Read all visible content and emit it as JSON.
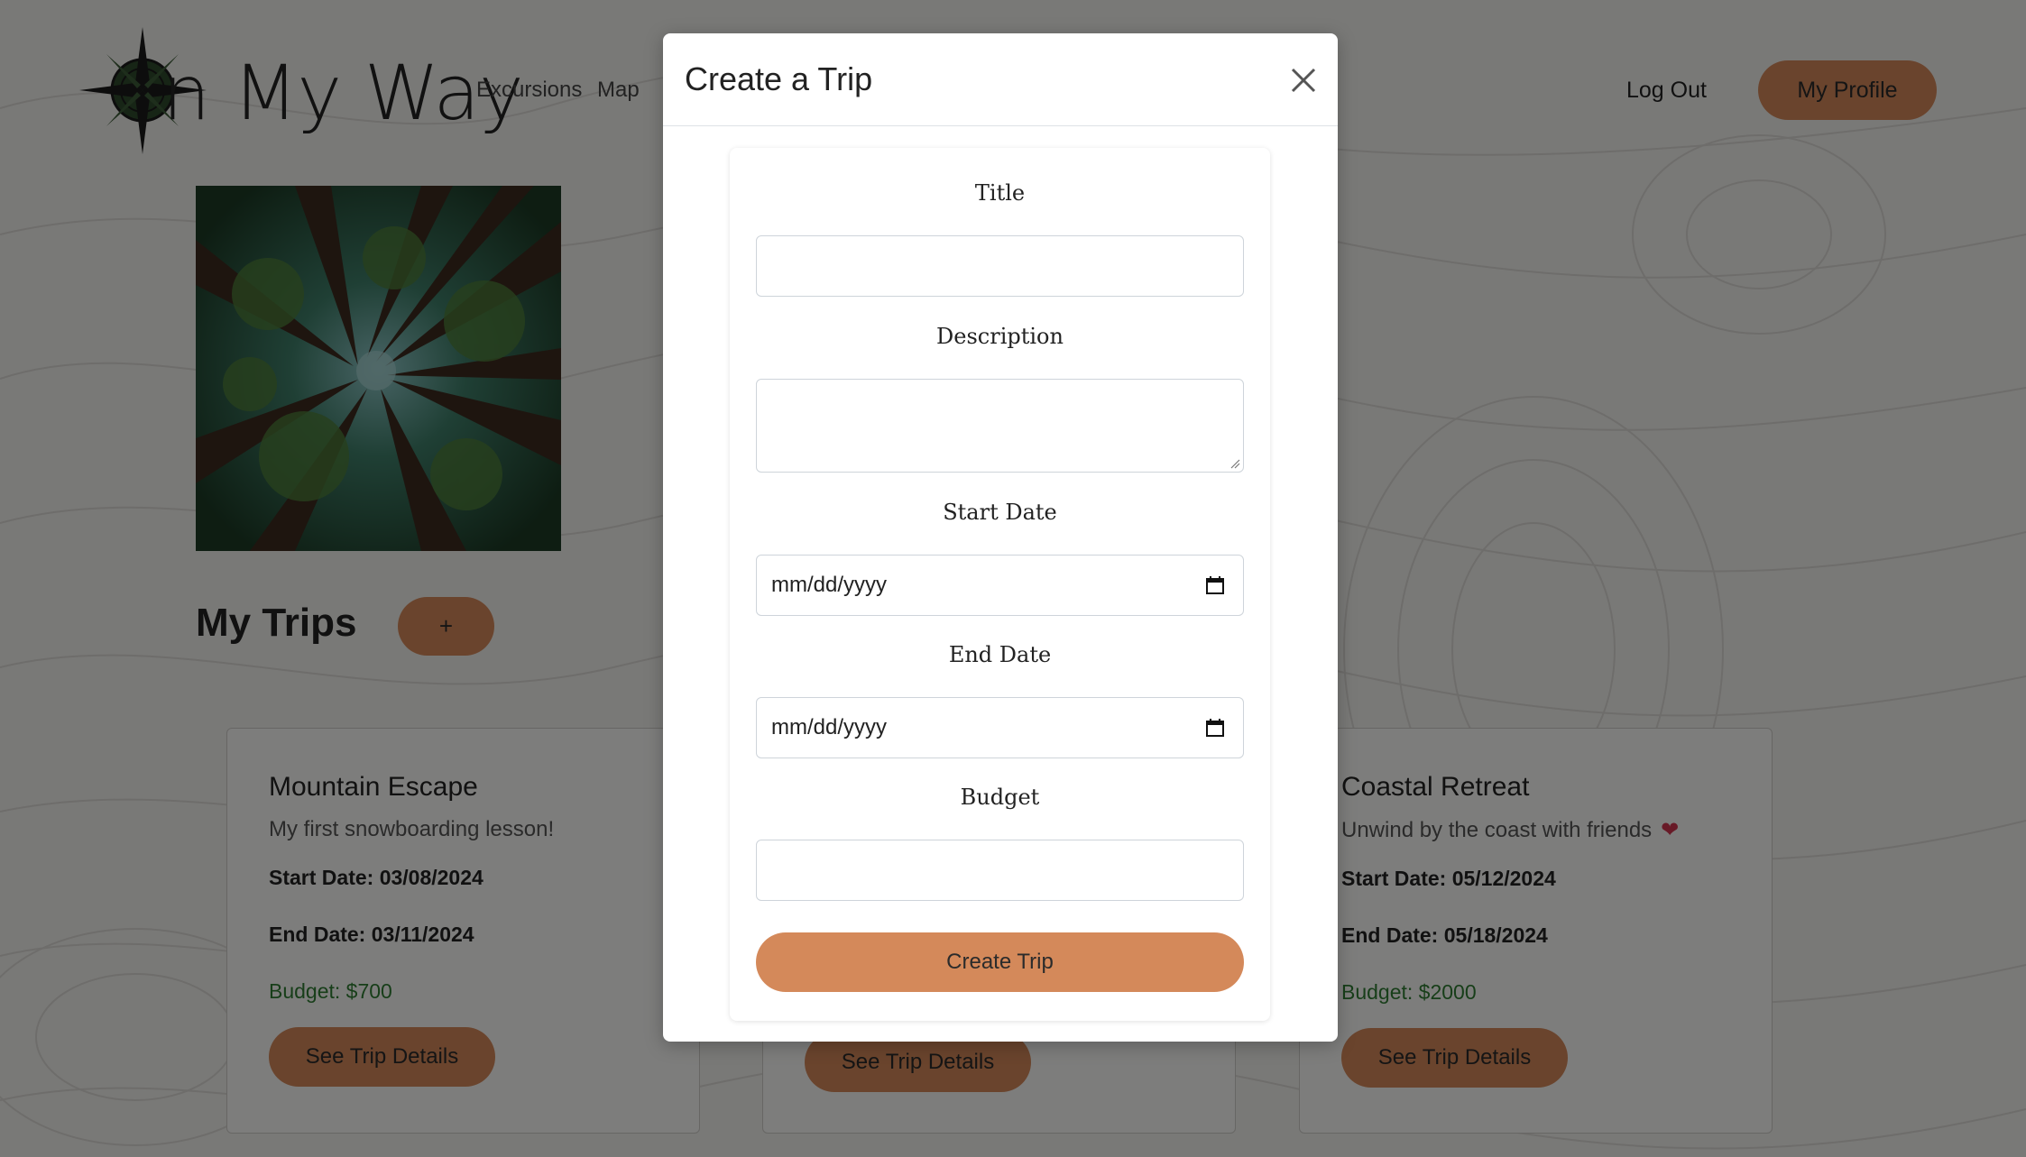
{
  "header": {
    "logo_text": "n My Way",
    "nav": [
      "Excursions",
      "Map"
    ],
    "logout_label": "Log Out",
    "profile_label": "My Profile"
  },
  "main": {
    "section_title": "My Trips",
    "add_button_label": "+"
  },
  "trips": [
    {
      "title": "Mountain Escape",
      "description": "My first snowboarding lesson!",
      "start": "Start Date: 03/08/2024",
      "end": "End Date: 03/11/2024",
      "budget": "Budget: $700",
      "button": "See Trip Details"
    },
    {
      "button": "See Trip Details"
    },
    {
      "title": "Coastal Retreat",
      "description": "Unwind by the coast with friends",
      "heart": "❤",
      "start": "Start Date: 05/12/2024",
      "end": "End Date: 05/18/2024",
      "budget": "Budget: $2000",
      "button": "See Trip Details"
    }
  ],
  "modal": {
    "title": "Create a Trip",
    "fields": {
      "title_label": "Title",
      "description_label": "Description",
      "start_label": "Start Date",
      "start_placeholder": "mm/dd/yyyy",
      "end_label": "End Date",
      "end_placeholder": "mm/dd/yyyy",
      "budget_label": "Budget"
    },
    "submit_label": "Create Trip"
  },
  "colors": {
    "accent": "#d4895a",
    "budget": "#2e7d32",
    "overlay": "rgba(0,0,0,0.5)"
  }
}
